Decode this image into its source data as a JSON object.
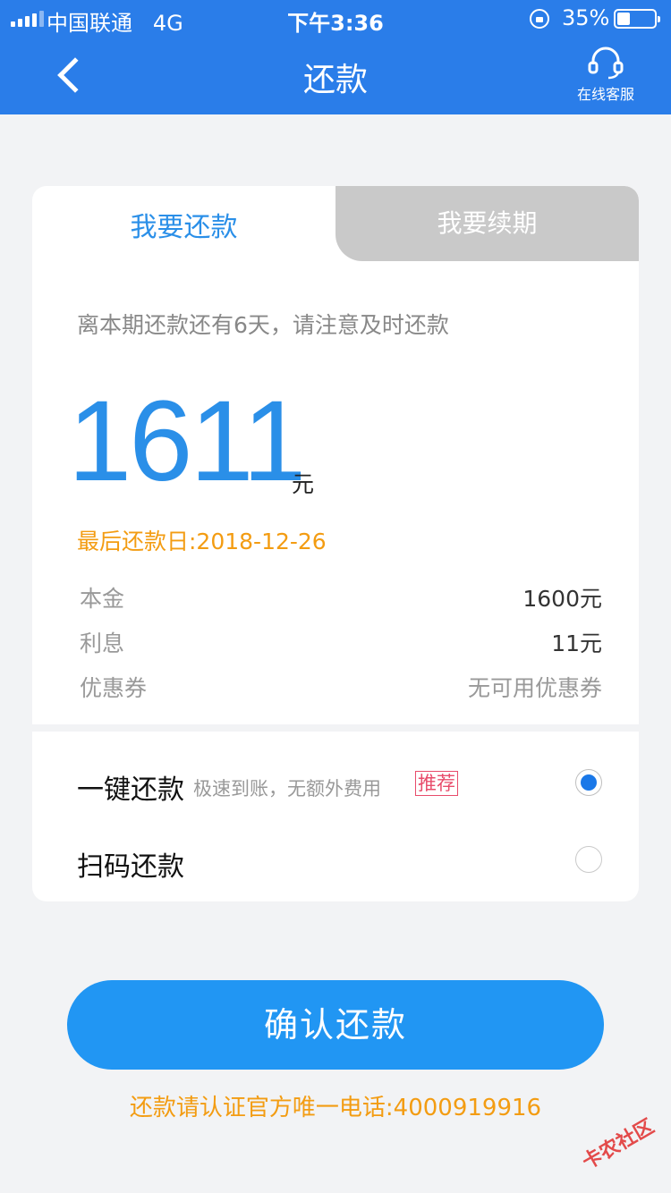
{
  "status_bar": {
    "carrier": "中国联通",
    "network": "4G",
    "time": "下午3:36",
    "battery_text": "35%",
    "battery_level": 0.35
  },
  "nav": {
    "title": "还款",
    "service_label": "在线客服"
  },
  "tabs": [
    {
      "label": "我要还款",
      "active": true
    },
    {
      "label": "我要续期",
      "active": false
    }
  ],
  "card": {
    "notice": "离本期还款还有6天，请注意及时还款",
    "amount": "1611",
    "amount_unit": "元",
    "due_date": "最后还款日:2018-12-26",
    "details": [
      {
        "label": "本金",
        "value": "1600元"
      },
      {
        "label": "利息",
        "value": "11元"
      },
      {
        "label": "优惠券",
        "value": "无可用优惠券"
      }
    ]
  },
  "options": [
    {
      "title": "一键还款",
      "subtitle": "极速到账，无额外费用",
      "badge": "推荐",
      "selected": true
    },
    {
      "title": "扫码还款",
      "selected": false
    }
  ],
  "confirm_label": "确认还款",
  "hotline": "还款请认证官方唯一电话:4000919916",
  "watermark": "卡农社区",
  "colors": {
    "header": "#2a7de9",
    "accent": "#2a8fe8",
    "warning": "#f39c12",
    "badge": "#e84c6b",
    "button": "#2196f3"
  }
}
